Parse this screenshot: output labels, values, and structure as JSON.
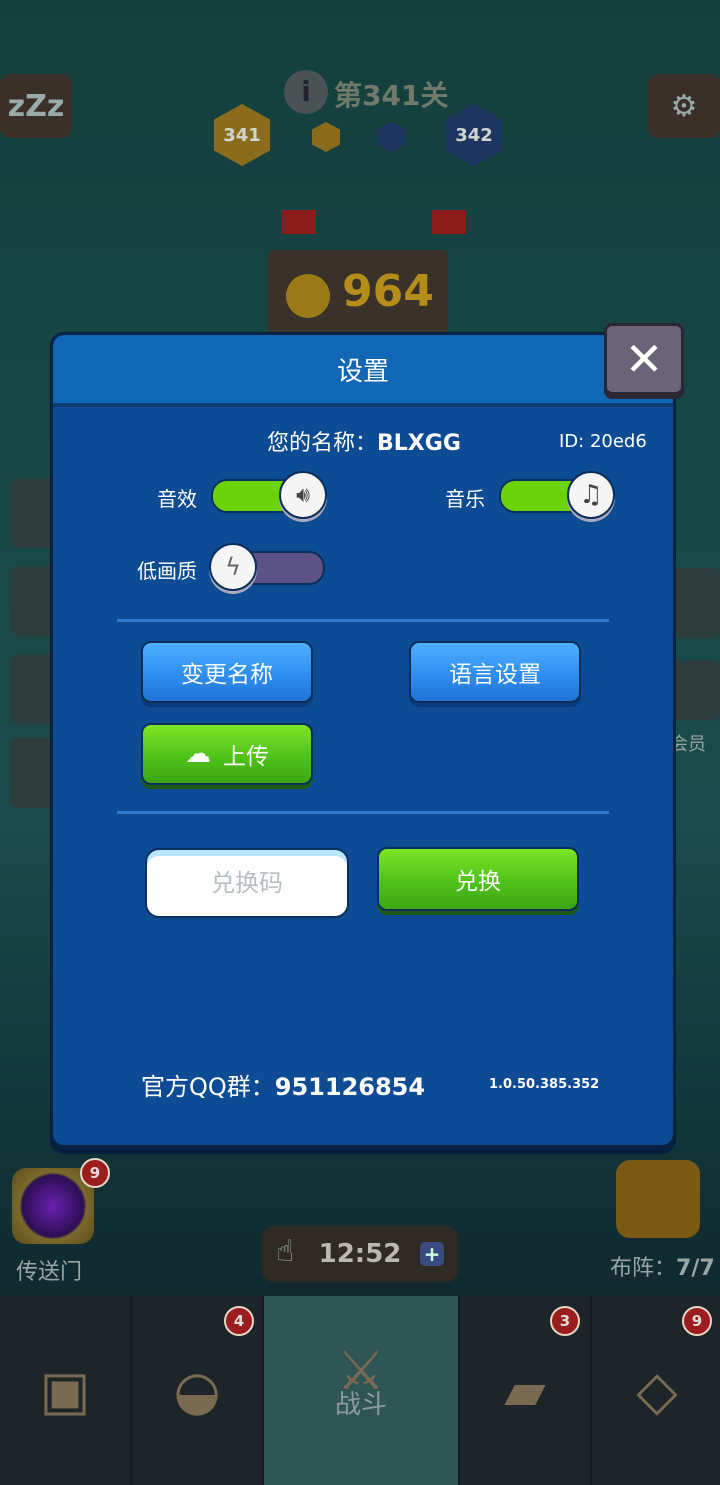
{
  "hud": {
    "level_title": "第341关",
    "current_level": "341",
    "next_level": "342",
    "coins": "964"
  },
  "left_dock": {
    "portal_label": "传送门",
    "portal_badge": "9"
  },
  "right_dock": {
    "formation_label": "布阵：",
    "formation_count": "7/7",
    "member_label": "会员"
  },
  "timer": {
    "value": "12:52",
    "plus": "+"
  },
  "bottom_nav": {
    "items": [
      {
        "name": "chest",
        "label": "",
        "badge": ""
      },
      {
        "name": "helmet",
        "label": "",
        "badge": "4"
      },
      {
        "name": "battle",
        "label": "战斗",
        "badge": ""
      },
      {
        "name": "spellbook",
        "label": "",
        "badge": "3"
      },
      {
        "name": "amulet",
        "label": "",
        "badge": "9"
      }
    ]
  },
  "dialog": {
    "title": "设置",
    "name_label": "您的名称：",
    "name_value": "BLXGG",
    "id_text": "ID: 20ed6",
    "sound_label": "音效",
    "sound_on": true,
    "music_label": "音乐",
    "music_on": true,
    "low_quality_label": "低画质",
    "low_quality_on": false,
    "rename_button": "变更名称",
    "language_button": "语言设置",
    "upload_button": "上传",
    "redeem_placeholder": "兑换码",
    "redeem_button": "兑换",
    "qq_label": "官方QQ群：",
    "qq_number": "951126854",
    "version": "1.0.50.385.352"
  },
  "colors": {
    "dialog_bg": "#0d4c94",
    "header_bg": "#1166b5",
    "toggle_on": "#6bd30c",
    "toggle_off": "#5b5385",
    "button_blue": "#2f8ef0",
    "button_green": "#4fc21a"
  }
}
